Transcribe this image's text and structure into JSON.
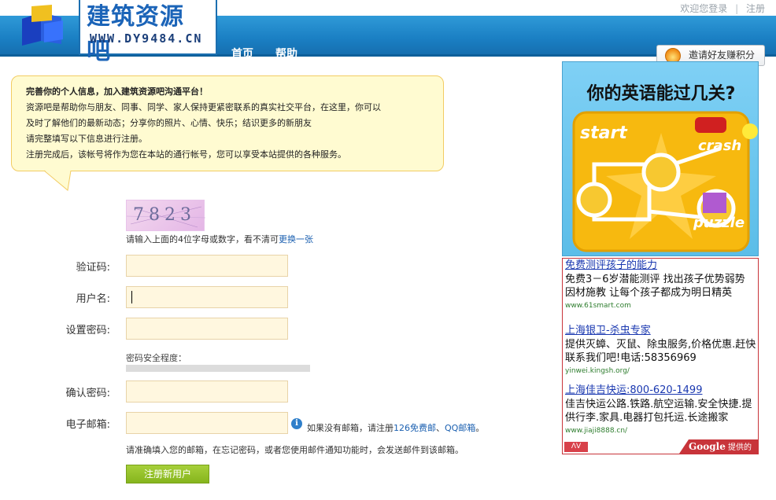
{
  "topbar": {
    "welcome": "欢迎您登录",
    "register": "注册"
  },
  "logo": {
    "title": "建筑资源吧",
    "url": "WWW.DY9484.CN"
  },
  "nav": [
    {
      "label": "首页"
    },
    {
      "label": "帮助"
    }
  ],
  "invite": {
    "label": "邀请好友赚积分"
  },
  "intro": {
    "heading": "完善你的个人信息，加入建筑资源吧沟通平台！",
    "lines": [
      "资源吧是帮助你与朋友、同事、同学、家人保持更紧密联系的真实社交平台，在这里，你可以",
      "及时了解他们的最新动态；分享你的照片、心情、快乐；结识更多的新朋友",
      "请完整填写以下信息进行注册。",
      "注册完成后，该帐号将作为您在本站的通行帐号，您可以享受本站提供的各种服务。"
    ]
  },
  "captcha": {
    "code": "7823",
    "hint": "请输入上面的4位字母或数字，看不清可",
    "refresh": "更换一张"
  },
  "form": {
    "verify_label": "验证码:",
    "username_label": "用户名:",
    "password_label": "设置密码:",
    "strength_label": "密码安全程度：",
    "confirm_label": "确认密码:",
    "email_label": "电子邮箱:",
    "email_hint_prefix": "如果没有邮箱，请注册",
    "email_link1": "126免费邮",
    "email_sep": "、",
    "email_link2": "QQ邮箱",
    "email_hint_suffix": "。",
    "email_note": "请准确填入您的邮箱，在忘记密码，或者您使用邮件通知功能时，会发送邮件到该邮箱。",
    "submit": "注册新用户"
  },
  "banner": {
    "title": "你的英语能过几关?",
    "start": "start",
    "crash": "crash",
    "puzzle": "puzzle"
  },
  "ads": [
    {
      "title": "免费测评孩子的能力",
      "desc": "免费3－6岁潜能测评 找出孩子优势弱势 因材施教 让每个孩子都成为明日精英",
      "url": "www.61smart.com"
    },
    {
      "title": "上海银卫-杀虫专家",
      "desc": "提供灭蟑、灭鼠、除虫服务,价格优惠.赶快联系我们吧!电话:58356969",
      "url": "yinwei.kingsh.org/"
    },
    {
      "title": "上海佳吉快运:800-620-1499",
      "desc": "佳吉快运公路.铁路.航空运输.安全快捷.提供行李.家具.电器打包托运.长途搬家",
      "url": "www.jiaji8888.cn/"
    }
  ],
  "ad_footer": {
    "arrows": "ΛV",
    "google": "Google",
    "label": "提供的广告"
  }
}
